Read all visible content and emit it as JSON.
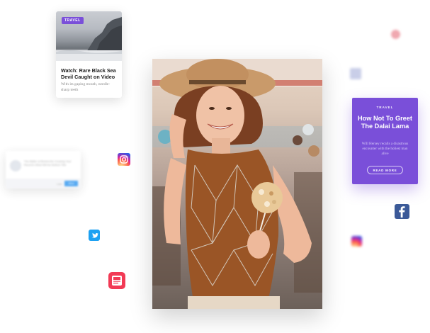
{
  "travel_card": {
    "badge": "TRAVEL",
    "headline": "Watch: Rare Black Sea Devil Caught on Video",
    "description": "With its gaping mouth, needle-sharp teeth"
  },
  "promo_card": {
    "label": "TRAVEL",
    "title": "How Not To Greet The Dalai Lama",
    "subtitle": "Will Hersey recalls a disastrous encounter with the holiest man alive",
    "button": "READ MORE"
  },
  "notification": {
    "text": "The Matter of Behind the Crossing Your Recent's What Will the Bottom Title",
    "cancel": "Later",
    "ok": "Allow"
  },
  "icons": {
    "instagram": "instagram-icon",
    "twitter": "twitter-icon",
    "news": "news-icon",
    "facebook": "facebook-icon"
  },
  "colors": {
    "accent_purple": "#7a4fd9",
    "twitter_blue": "#1da1f2",
    "facebook_blue": "#3b5998",
    "news_red": "#f23a55"
  }
}
